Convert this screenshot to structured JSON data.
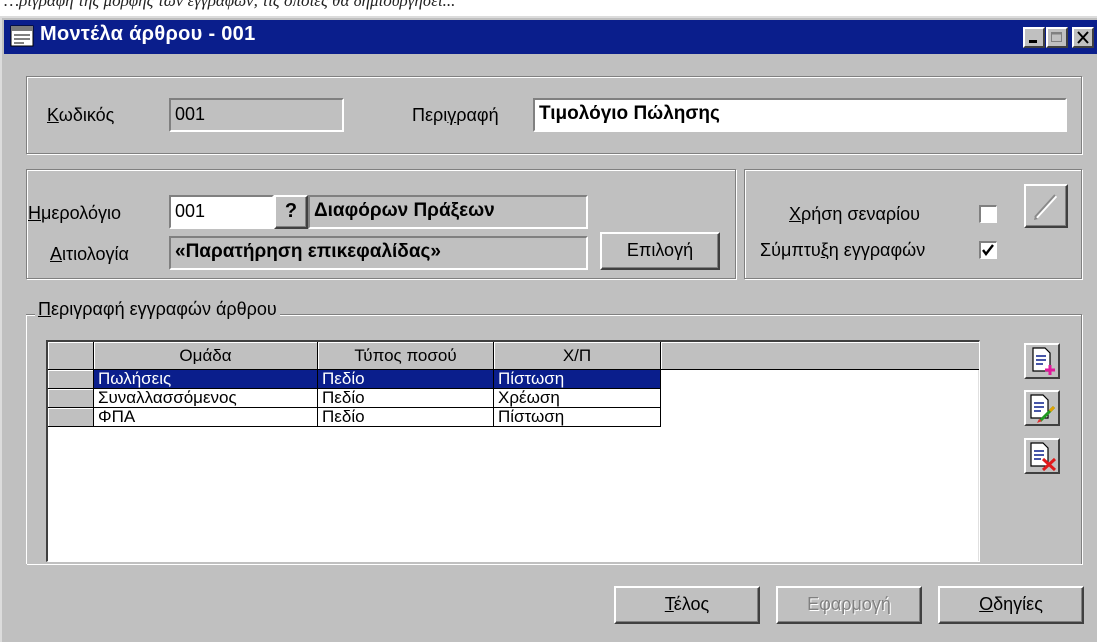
{
  "context_caption": "…ριγραφή της μορφής των εγγραφών, τις οποίες θα δημιουργήσει...",
  "window": {
    "title": "Μοντέλα άρθρου - 001",
    "icon": "window-form-icon",
    "controls": [
      "minimize-icon",
      "maximize-icon",
      "close-icon"
    ]
  },
  "header": {
    "code_label_u": "Κ",
    "code_label_rest": "ωδικός",
    "code_value": "001",
    "description_label_pre": "Περι",
    "description_label_u": "γ",
    "description_label_post": "ραφή",
    "description_value": "Τιμολόγιο Πώλησης"
  },
  "journal": {
    "calendar_label_u": "Η",
    "calendar_label_rest": "μερολόγιο",
    "calendar_code": "001",
    "lookup_symbol": "?",
    "calendar_name": "Διαφόρων Πράξεων",
    "reason_label_u": "Α",
    "reason_label_rest": "ιτιολογία",
    "reason_value": "«Παρατήρηση επικεφαλίδας»",
    "select_button": "Επιλογή"
  },
  "options": {
    "scenario_label_u": "Χ",
    "scenario_label_rest": "ρήση σεναρίου",
    "scenario_checked": false,
    "merge_label_pre": "Σύμπτυ",
    "merge_label_u": "ξ",
    "merge_label_post": "η εγγραφών",
    "merge_checked": true,
    "scenario_button_icon": "pencil-disabled-icon"
  },
  "entries": {
    "group_title_u": "Π",
    "group_title_rest": "εριγραφή εγγραφών άρθρου",
    "columns": [
      "Ομάδα",
      "Τύπος ποσού",
      "Χ/Π"
    ],
    "rows": [
      {
        "group": "Πωλήσεις",
        "amount_type": "Πεδίο",
        "dc": "Πίστωση",
        "selected": true
      },
      {
        "group": "Συναλλασσόμενος",
        "amount_type": "Πεδίο",
        "dc": "Χρέωση",
        "selected": false
      },
      {
        "group": "ΦΠΑ",
        "amount_type": "Πεδίο",
        "dc": "Πίστωση",
        "selected": false
      }
    ],
    "side_buttons": [
      "add-row-icon",
      "edit-row-icon",
      "delete-row-icon"
    ]
  },
  "footer": {
    "finish_u": "Τ",
    "finish_rest": "έλος",
    "apply": "Εφαρμογή",
    "help_u": "Ο",
    "help_rest": "δηγίες"
  },
  "colors": {
    "titlebar": "#0a1e8c",
    "dialog_face": "#c0c0c0",
    "selection": "#0a1e8c"
  }
}
